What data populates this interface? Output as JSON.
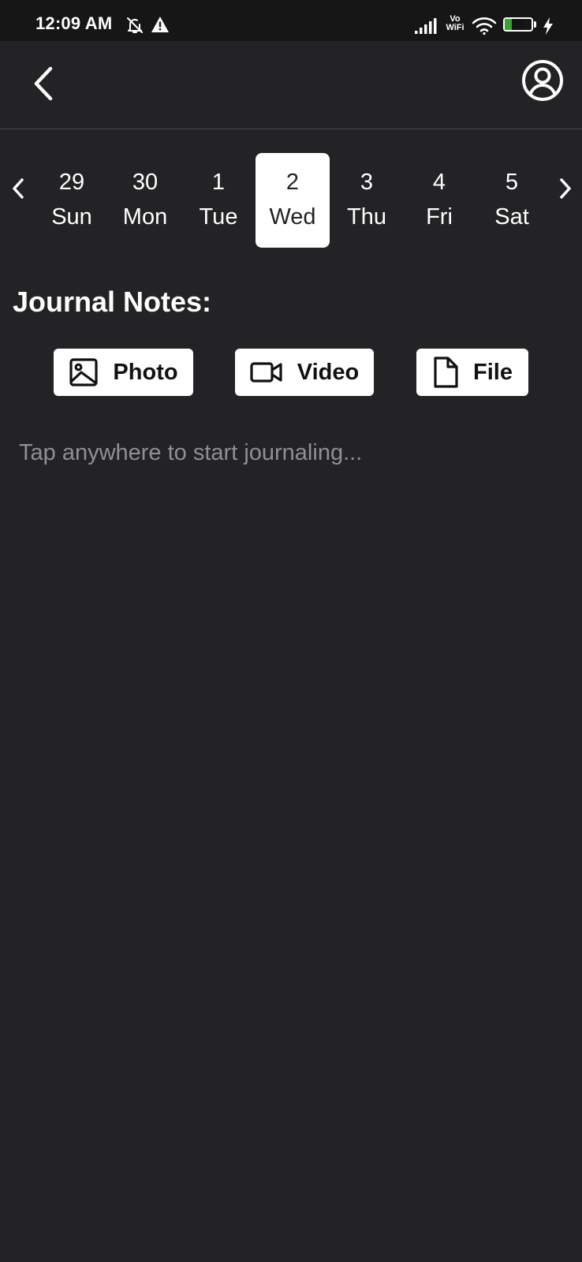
{
  "status_bar": {
    "time": "12:09 AM",
    "icons": [
      "bell-off-icon",
      "warning-icon",
      "signal-icon",
      "vowifi-icon",
      "wifi-icon",
      "battery-icon",
      "charging-icon"
    ],
    "vowifi_top": "Vo",
    "vowifi_bottom": "WiFi",
    "battery_level": "25",
    "battery_fraction": 0.25,
    "battery_color": "#3aa235"
  },
  "header": {
    "back_icon": "chevron-left-icon",
    "profile_icon": "user-circle-icon"
  },
  "day_strip": {
    "prev_icon": "chevron-left-icon",
    "next_icon": "chevron-right-icon",
    "selected_index": 3,
    "days": [
      {
        "num": "29",
        "name": "Sun"
      },
      {
        "num": "30",
        "name": "Mon"
      },
      {
        "num": "1",
        "name": "Tue"
      },
      {
        "num": "2",
        "name": "Wed"
      },
      {
        "num": "3",
        "name": "Thu"
      },
      {
        "num": "4",
        "name": "Fri"
      },
      {
        "num": "5",
        "name": "Sat"
      }
    ]
  },
  "journal": {
    "title": "Journal Notes:",
    "buttons": {
      "photo": {
        "label": "Photo",
        "icon": "image-icon"
      },
      "video": {
        "label": "Video",
        "icon": "video-camera-icon"
      },
      "file": {
        "label": "File",
        "icon": "file-icon"
      }
    },
    "placeholder": "Tap anywhere to start journaling..."
  },
  "colors": {
    "background": "#232325",
    "status_bar": "#161617",
    "selected_day_bg": "#ffffff",
    "placeholder_text": "#8f8f95"
  }
}
